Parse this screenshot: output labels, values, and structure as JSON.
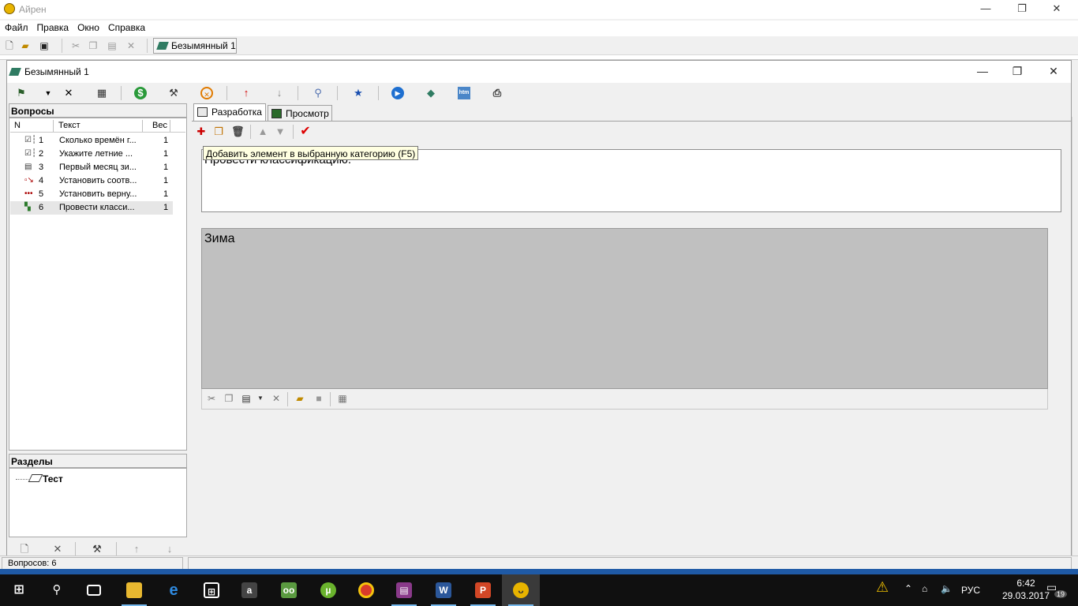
{
  "app": {
    "title": "Айрен",
    "menu": [
      "Файл",
      "Правка",
      "Окно",
      "Справка"
    ],
    "doc_tab": "Безымянный 1"
  },
  "child": {
    "title": "Безымянный 1"
  },
  "questions": {
    "header": "Вопросы",
    "columns": {
      "n": "N",
      "text": "Текст",
      "weight": "Вес"
    },
    "rows": [
      {
        "n": "1",
        "text": "Сколько времён г...",
        "weight": "1",
        "icon": "single-choice-icon"
      },
      {
        "n": "2",
        "text": "Укажите летние ...",
        "weight": "1",
        "icon": "multi-choice-icon"
      },
      {
        "n": "3",
        "text": "Первый месяц зи...",
        "weight": "1",
        "icon": "text-input-icon"
      },
      {
        "n": "4",
        "text": "Установить соотв...",
        "weight": "1",
        "icon": "matching-icon"
      },
      {
        "n": "5",
        "text": "Установить верну...",
        "weight": "1",
        "icon": "ordering-icon"
      },
      {
        "n": "6",
        "text": "Провести класси...",
        "weight": "1",
        "icon": "classification-icon"
      }
    ]
  },
  "sections": {
    "header": "Разделы",
    "root": "Тест"
  },
  "tabs": [
    {
      "label": "Разработка",
      "active": true
    },
    {
      "label": "Просмотр",
      "active": false
    }
  ],
  "tooltip": "Добавить элемент в выбранную категорию (F5)",
  "question_text": "Провести классификацию.",
  "category": "Зима",
  "status": {
    "count": "Вопросов: 6"
  },
  "taskbar": {
    "lang": "РУС",
    "time": "6:42",
    "date": "29.03.2017",
    "notifications": "19"
  },
  "colors": {
    "accent": "#1f5aa6",
    "answer_bg": "#c0c0c0",
    "tooltip_bg": "#ffffe1"
  }
}
